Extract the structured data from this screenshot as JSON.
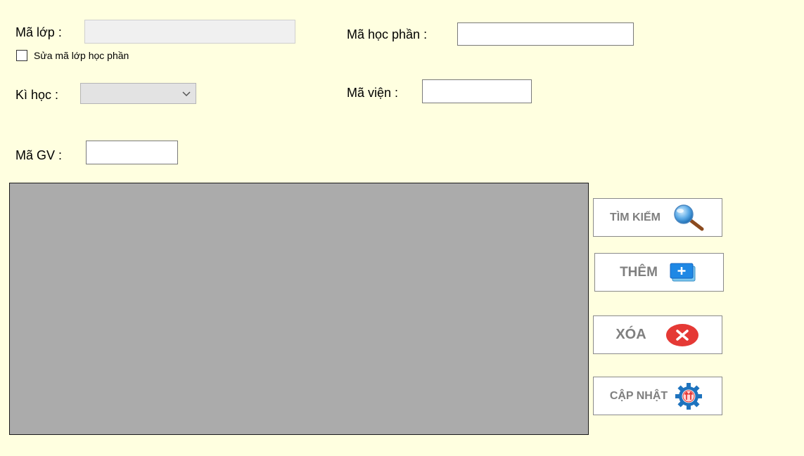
{
  "form": {
    "ma_lop_label": "Mã lớp :",
    "ma_lop_value": "",
    "sua_ma_lop_label": "Sửa mã lớp học phần",
    "sua_ma_lop_checked": false,
    "ma_hoc_phan_label": "Mã học phần :",
    "ma_hoc_phan_value": "",
    "ki_hoc_label": "Kì học :",
    "ki_hoc_selected": "",
    "ma_vien_label": "Mã viện :",
    "ma_vien_value": "",
    "ma_gv_label": "Mã GV :",
    "ma_gv_value": ""
  },
  "buttons": {
    "tim_kiem": "TÌM KIẾM",
    "them": "THÊM",
    "xoa": "XÓA",
    "cap_nhat": "CẬP NHẬT"
  },
  "icons": {
    "tim_kiem": "magnifier-icon",
    "them": "add-stack-icon",
    "xoa": "delete-circle-icon",
    "cap_nhat": "update-gear-icon"
  },
  "colors": {
    "background": "#ffffe0",
    "grid": "#ababab",
    "button_text": "#7f7f7f",
    "delete_red": "#e53935",
    "add_blue": "#1e88e5"
  }
}
